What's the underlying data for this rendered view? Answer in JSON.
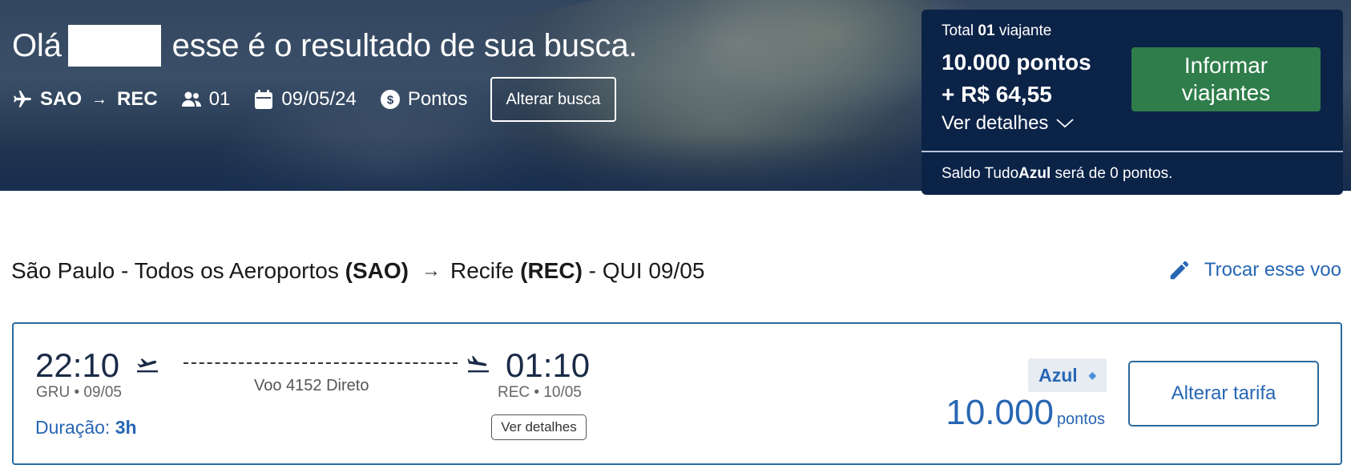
{
  "hero": {
    "greeting_before": "Olá",
    "greeting_after": "esse é o resultado de sua busca.",
    "search": {
      "origin": "SAO",
      "destination": "REC",
      "passengers": "01",
      "date": "09/05/24",
      "fare_type": "Pontos",
      "change_search_label": "Alterar busca"
    }
  },
  "summary": {
    "total_prefix": "Total",
    "total_count": "01",
    "total_suffix": "viajante",
    "points_line": "10.000 pontos",
    "money_line": "+ R$ 64,55",
    "details_label": "Ver detalhes",
    "inform_button_label": "Informar viajantes",
    "balance_prefix": "Saldo Tudo",
    "balance_brand": "Azul",
    "balance_suffix": "será de 0 pontos."
  },
  "route": {
    "origin_text": "São Paulo - Todos os Aeroportos",
    "origin_code": "(SAO)",
    "destination_text": "Recife",
    "destination_code": "(REC)",
    "date_text": "- QUI 09/05",
    "swap_label": "Trocar esse voo"
  },
  "flight": {
    "departure_time": "22:10",
    "departure_sub": "GRU • 09/05",
    "arrival_time": "01:10",
    "arrival_sub": "REC • 10/05",
    "flight_info": "Voo 4152 Direto",
    "duration_label": "Duração:",
    "duration_value": "3h",
    "details_button_label": "Ver detalhes",
    "fare_name": "Azul",
    "fare_points": "10.000",
    "fare_unit": "pontos",
    "change_fare_label": "Alterar tarifa"
  },
  "colors": {
    "summary_bg": "#0c2348",
    "primary_green": "#2e7d4a",
    "link_blue": "#2766b3",
    "card_border": "#2b6a9e"
  },
  "icons": {
    "plane": "airplane-icon",
    "passengers": "people-icon",
    "calendar": "calendar-icon",
    "fare": "dollar-coin-icon",
    "edit": "pencil-icon",
    "takeoff": "takeoff-icon",
    "landing": "landing-icon",
    "chevron": "chevron-down-icon"
  }
}
